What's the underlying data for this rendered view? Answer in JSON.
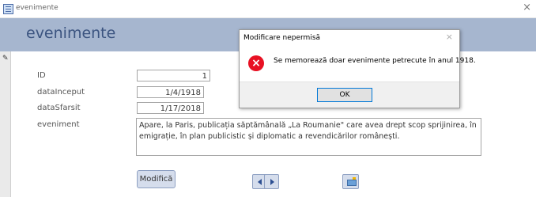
{
  "window": {
    "title": "evenimente",
    "close_glyph": "×"
  },
  "form": {
    "title": "evenimente",
    "record_selector_icon": "pencil-icon",
    "fields": {
      "id": {
        "label": "ID",
        "value": "1"
      },
      "data_inceput": {
        "label": "dataInceput",
        "value": "1/4/1918"
      },
      "data_sfarsit": {
        "label": "dataSfarsit",
        "value": "1/17/2018"
      },
      "eveniment": {
        "label": "eveniment",
        "value": "Apare, la Paris, publicația săptămânală „La Roumanie\" care avea drept scop sprijinirea, în emigrație, în plan publicistic și diplomatic a revendicărilor românești."
      }
    },
    "buttons": {
      "modifica": "Modifică",
      "prev_icon": "arrow-left-icon",
      "next_icon": "arrow-right-icon",
      "image_icon": "image-icon"
    }
  },
  "dialog": {
    "title": "Modificare nepermisă",
    "close_glyph": "×",
    "icon": "error-icon",
    "icon_glyph": "×",
    "message": "Se memorează doar evenimente petrecute în anul 1918.",
    "ok_label": "OK"
  },
  "colors": {
    "header_band": "#a6b6cf",
    "form_title": "#3b5480",
    "error_red": "#e81123",
    "button_fill": "#d5ddec",
    "focus_blue": "#0078d7"
  }
}
